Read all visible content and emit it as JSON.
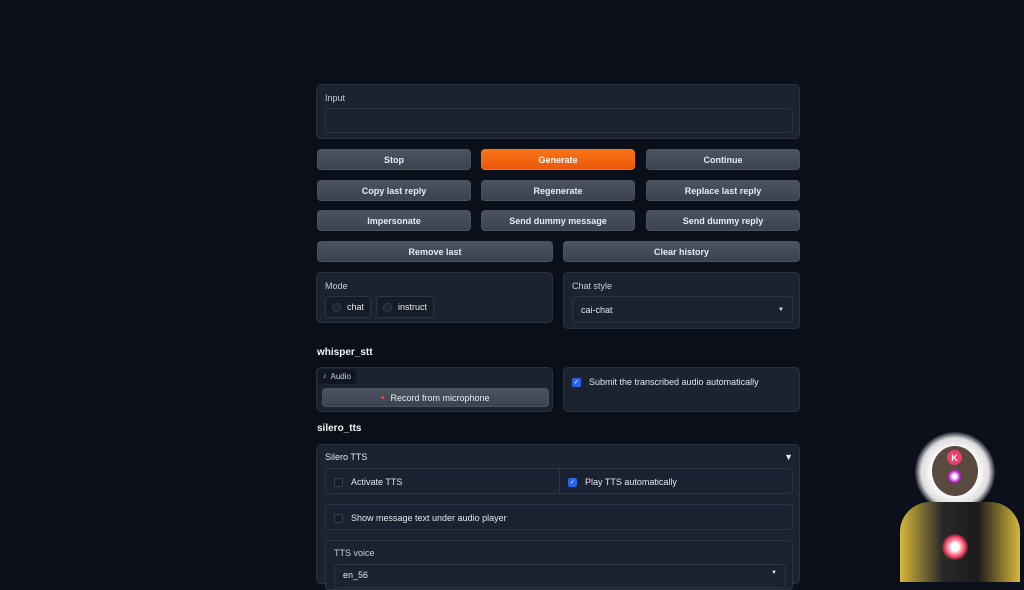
{
  "input": {
    "label": "Input",
    "value": ""
  },
  "buttons": {
    "stop": "Stop",
    "generate": "Generate",
    "continue": "Continue",
    "copy_last_reply": "Copy last reply",
    "regenerate": "Regenerate",
    "replace_last_reply": "Replace last reply",
    "impersonate": "Impersonate",
    "send_dummy_message": "Send dummy message",
    "send_dummy_reply": "Send dummy reply",
    "remove_last": "Remove last",
    "clear_history": "Clear history"
  },
  "mode": {
    "label": "Mode",
    "options": [
      "chat",
      "instruct"
    ]
  },
  "chat_style": {
    "label": "Chat style",
    "value": "cai-chat"
  },
  "whisper": {
    "title": "whisper_stt",
    "audio_tab": "Audio",
    "record": "Record from microphone",
    "submit_label": "Submit the transcribed audio automatically",
    "submit_checked": true
  },
  "silero": {
    "title": "silero_tts",
    "accordion": "Silero TTS",
    "activate": "Activate TTS",
    "activate_checked": false,
    "play_auto": "Play TTS automatically",
    "play_auto_checked": true,
    "show_text": "Show message text under audio player",
    "show_text_checked": false,
    "voice_label": "TTS voice",
    "voice_value": "en_56"
  },
  "overlay": {
    "badge": "K"
  },
  "colors": {
    "accent": "#f97316",
    "check": "#2563eb",
    "bg": "#0b0f19"
  }
}
